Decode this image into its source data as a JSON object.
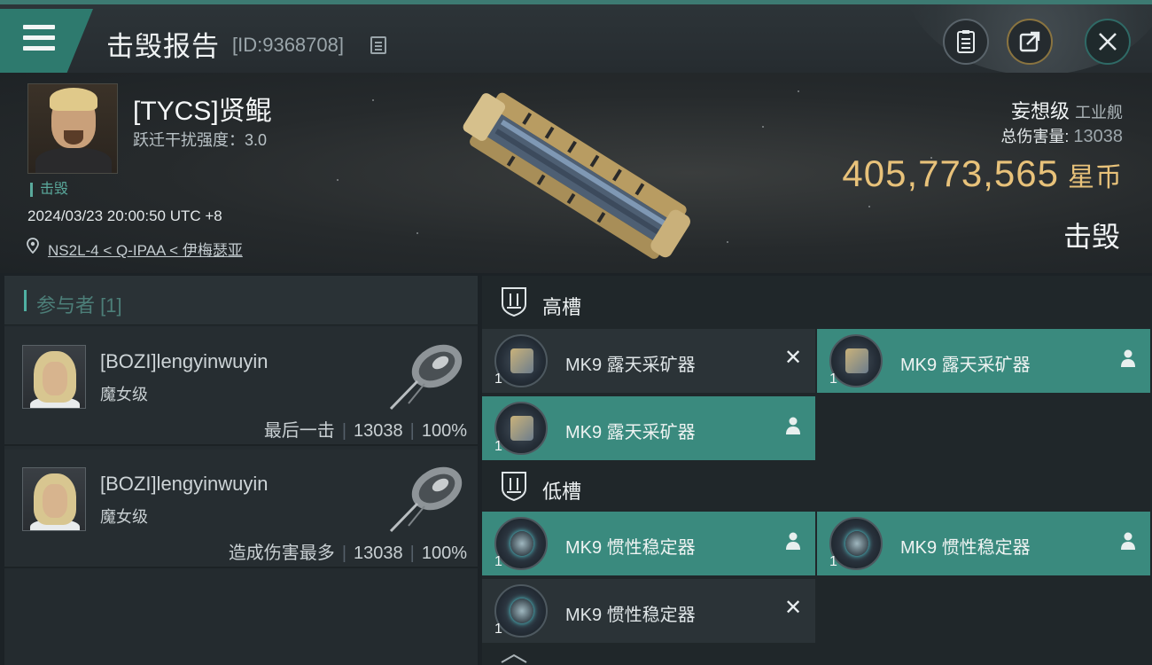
{
  "header": {
    "title": "击毁报告",
    "id_label": "[ID:9368708]"
  },
  "victim": {
    "name": "[TYCS]贤鲲",
    "warp_scramble": "跃迁干扰强度：3.0",
    "tag": "击毁",
    "datetime": "2024/03/23 20:00:50 UTC +8",
    "location": "NS2L-4 < Q-IPAA < 伊梅瑟亚"
  },
  "summary": {
    "ship_class": "妄想级",
    "ship_type": "工业舰",
    "total_damage_label": "总伤害量:",
    "total_damage_value": "13038",
    "isk_value": "405,773,565",
    "isk_unit": "星币",
    "status": "击毁"
  },
  "participants": {
    "header": "参与者 [1]",
    "rows": [
      {
        "name": "[BOZI]lengyinwuyin",
        "ship": "魔女级",
        "role": "最后一击",
        "damage": "13038",
        "percent": "100%"
      },
      {
        "name": "[BOZI]lengyinwuyin",
        "ship": "魔女级",
        "role": "造成伤害最多",
        "damage": "13038",
        "percent": "100%"
      }
    ]
  },
  "fitting": {
    "high_slot_label": "高槽",
    "low_slot_label": "低槽",
    "high_items": [
      {
        "name": "MK9 露天采矿器",
        "qty": "1",
        "status": "destroyed"
      },
      {
        "name": "MK9 露天采矿器",
        "qty": "1",
        "status": "dropped"
      },
      {
        "name": "MK9 露天采矿器",
        "qty": "1",
        "status": "dropped"
      }
    ],
    "low_items": [
      {
        "name": "MK9 惯性稳定器",
        "qty": "1",
        "status": "dropped"
      },
      {
        "name": "MK9 惯性稳定器",
        "qty": "1",
        "status": "dropped"
      },
      {
        "name": "MK9 惯性稳定器",
        "qty": "1",
        "status": "destroyed"
      }
    ]
  },
  "icons": {
    "menu": "menu-icon",
    "copy": "copy-icon",
    "report": "report-icon",
    "share": "share-icon",
    "close": "close-icon",
    "location": "location-pin-icon",
    "slot": "shield-slot-icon",
    "destroyed": "x-icon",
    "dropped": "person-icon"
  },
  "colors": {
    "accent_teal": "#3a8a7e",
    "isk_gold": "#e8c27a",
    "panel_dark": "#242b2f"
  }
}
